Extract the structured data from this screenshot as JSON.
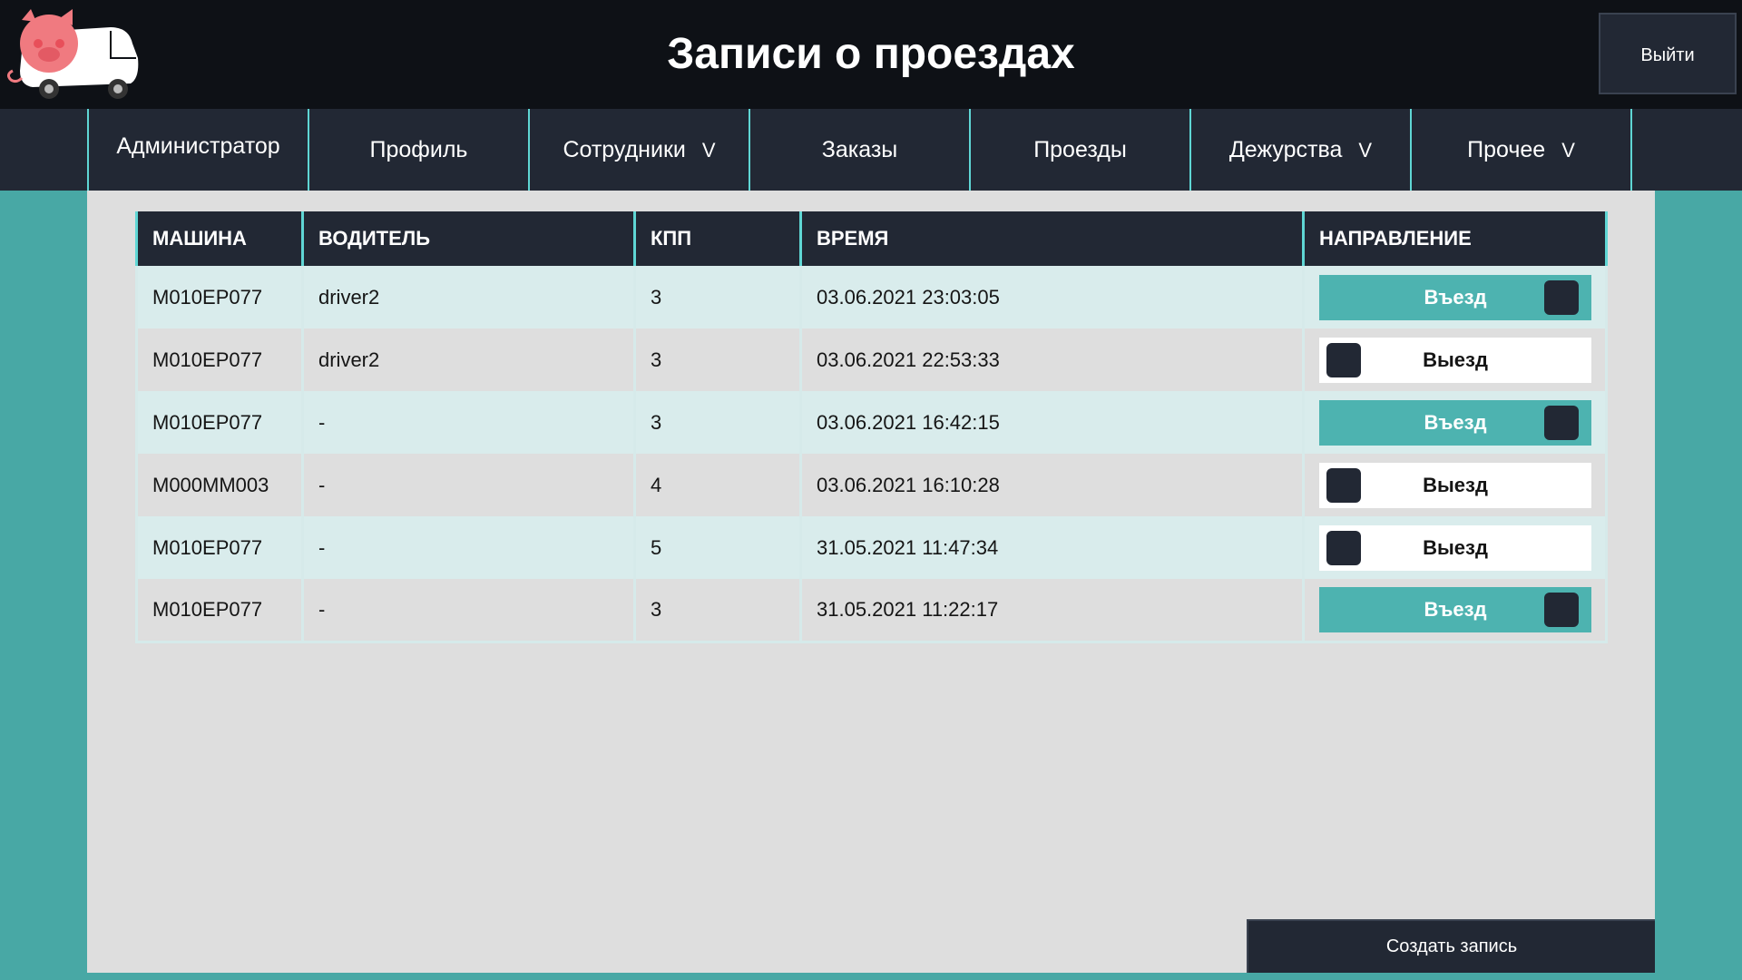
{
  "header": {
    "title": "Записи о проездах",
    "logout_label": "Выйти",
    "logo_icon": "pig-truck-logo-icon"
  },
  "nav": {
    "items": [
      {
        "label": "Администратор",
        "has_caret": false
      },
      {
        "label": "Профиль",
        "has_caret": false
      },
      {
        "label": "Сотрудники",
        "has_caret": true
      },
      {
        "label": "Заказы",
        "has_caret": false
      },
      {
        "label": "Проезды",
        "has_caret": false
      },
      {
        "label": "Дежурства",
        "has_caret": true
      },
      {
        "label": "Прочее",
        "has_caret": true
      }
    ],
    "caret": "V"
  },
  "table": {
    "columns": [
      "МАШИНА",
      "ВОДИТЕЛЬ",
      "КПП",
      "ВРЕМЯ",
      "НАПРАВЛЕНИЕ"
    ],
    "rows": [
      {
        "car": "М010ЕР077",
        "driver": "driver2",
        "checkpoint": "3",
        "time": "03.06.2021 23:03:05",
        "direction": "Въезд"
      },
      {
        "car": "М010ЕР077",
        "driver": "driver2",
        "checkpoint": "3",
        "time": "03.06.2021 22:53:33",
        "direction": "Выезд"
      },
      {
        "car": "М010ЕР077",
        "driver": "-",
        "checkpoint": "3",
        "time": "03.06.2021 16:42:15",
        "direction": "Въезд"
      },
      {
        "car": "М000ММ003",
        "driver": "-",
        "checkpoint": "4",
        "time": "03.06.2021 16:10:28",
        "direction": "Выезд"
      },
      {
        "car": "М010ЕР077",
        "driver": "-",
        "checkpoint": "5",
        "time": "31.05.2021 11:47:34",
        "direction": "Выезд"
      },
      {
        "car": "М010ЕР077",
        "driver": "-",
        "checkpoint": "3",
        "time": "31.05.2021 11:22:17",
        "direction": "Въезд"
      }
    ]
  },
  "create_label": "Создать запись",
  "colors": {
    "teal_background": "#48a8a5",
    "header_dark": "#0e1116",
    "nav_dark": "#222834",
    "accent_cyan": "#5fd6d4",
    "toggle_in": "#4db3b0",
    "panel": "#dedede"
  }
}
